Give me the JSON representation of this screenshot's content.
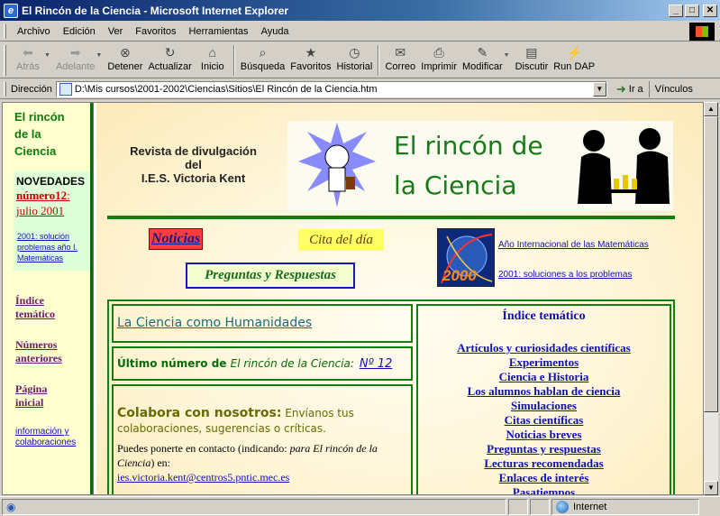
{
  "window": {
    "title": "El Rincón de la Ciencia - Microsoft Internet Explorer"
  },
  "menu": [
    "Archivo",
    "Edición",
    "Ver",
    "Favoritos",
    "Herramientas",
    "Ayuda"
  ],
  "toolbar": {
    "back": "Atrás",
    "forward": "Adelante",
    "stop": "Detener",
    "refresh": "Actualizar",
    "home": "Inicio",
    "search": "Búsqueda",
    "favorites": "Favoritos",
    "history": "Historial",
    "mail": "Correo",
    "print": "Imprimir",
    "edit": "Modificar",
    "discuss": "Discutir",
    "rundap": "Run DAP"
  },
  "address": {
    "label": "Dirección",
    "url": "D:\\Mis cursos\\2001-2002\\Ciencias\\Sitios\\El Rincón de la Ciencia.htm",
    "go": "Ir a",
    "links": "Vínculos"
  },
  "left": {
    "title_lines": [
      "El rincón",
      "de la",
      "Ciencia"
    ],
    "news_head": "NOVEDADES",
    "issue_1": "número12",
    "issue_2": "julio 2001",
    "sol_lines": [
      "2001: solución",
      "problemas año I.",
      " Matemáticas"
    ],
    "indice_1": "Índice",
    "indice_2": "temático",
    "numeros_1": "Números",
    "numeros_2": "anteriores",
    "pagina_1": "Página",
    "pagina_2": "inicial",
    "info_1": "información y",
    "info_2": "colaboraciones"
  },
  "main": {
    "mag_1": "Revista de divulgación",
    "mag_2": "del",
    "mag_3": "I.E.S. Victoria Kent",
    "banner_1": "El rincón de",
    "banner_2": "la Ciencia",
    "noticias": "Noticias",
    "cita": "Cita del día",
    "preguntas": "Preguntas y Respuestas",
    "y2000": "2000",
    "aim": "Año Internacional de las Matemáticas",
    "sol2001": "2001: soluciones a los problemas",
    "ciencia_hum": "La Ciencia como Humanidades",
    "ultimo_a": "Último número de ",
    "ultimo_b": "El rincón de la Ciencia:",
    "ultimo_num": "Nº 12",
    "colabora_big": "Colabora con nosotros:",
    "colabora_rest": " Envíanos tus colaboraciones, sugerencias o críticas.",
    "contact_a": "Puedes ponerte en contacto (indicando: ",
    "contact_b": "para El rincón de la Ciencia",
    "contact_c": ") en:",
    "email": "ies.victoria.kent@centros5.pntic.mec.es",
    "indice_head": "Índice temático",
    "indice_items": [
      "Artículos y curiosidades científicas",
      "Experimentos",
      "Ciencia e Historia",
      "Los alumnos hablan de ciencia",
      "Simulaciones",
      "Citas científicas",
      "Noticias breves",
      "Preguntas y respuestas",
      "Lecturas recomendadas",
      "Enlaces de interés",
      "Pasatiempos"
    ]
  },
  "status": {
    "zone": "Internet"
  }
}
